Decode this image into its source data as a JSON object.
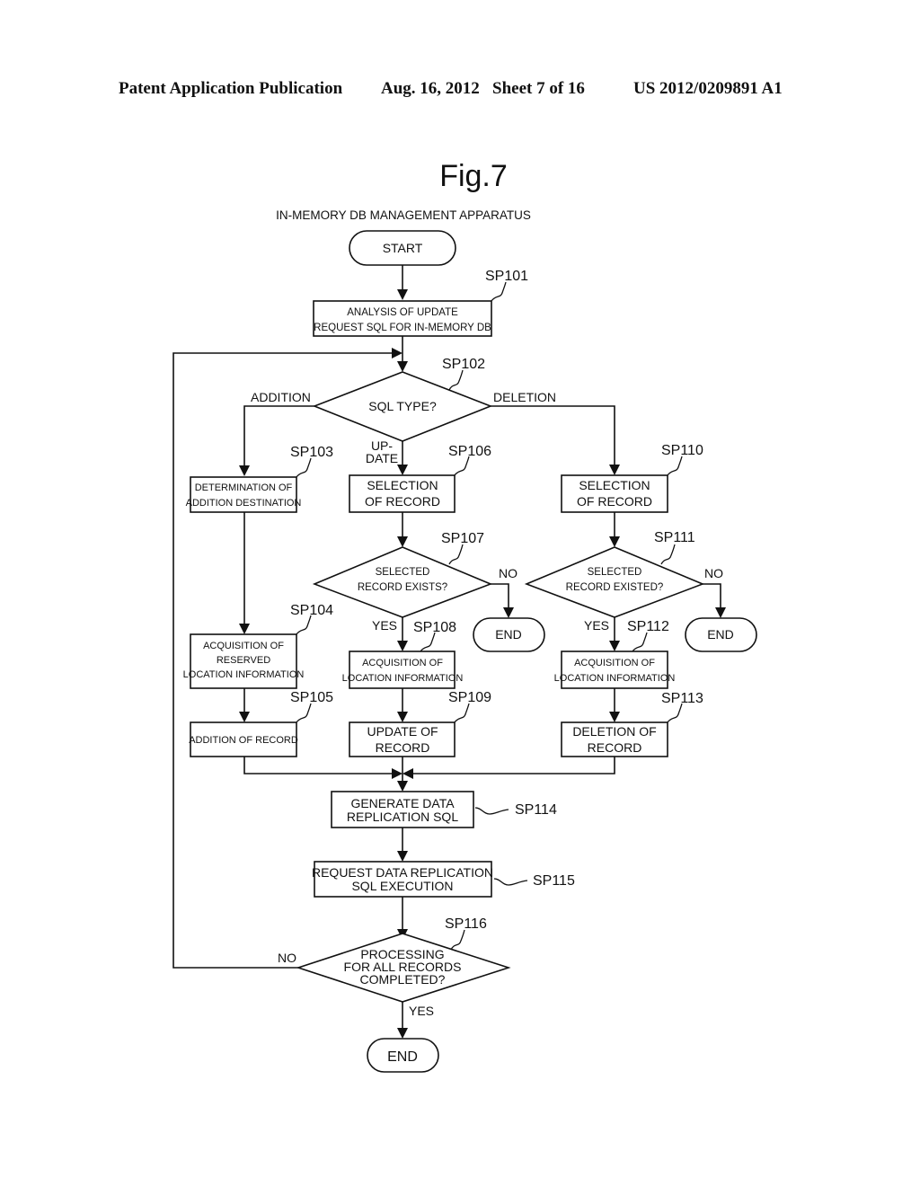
{
  "header": {
    "publication": "Patent Application Publication",
    "date": "Aug. 16, 2012",
    "sheet": "Sheet 7 of 16",
    "number": "US 2012/0209891 A1"
  },
  "figure": {
    "title": "Fig.7",
    "subtitle": "IN-MEMORY DB MANAGEMENT APPARATUS"
  },
  "nodes": {
    "start": {
      "label": "START"
    },
    "sp101": {
      "step": "SP101",
      "lines": [
        "ANALYSIS OF UPDATE",
        "REQUEST SQL FOR IN-MEMORY DB"
      ]
    },
    "sp102": {
      "step": "SP102",
      "lines": [
        "SQL TYPE?"
      ]
    },
    "sp103": {
      "step": "SP103",
      "lines": [
        "DETERMINATION OF",
        "ADDITION DESTINATION"
      ]
    },
    "sp104": {
      "step": "SP104",
      "lines": [
        "ACQUISITION OF",
        "RESERVED",
        "LOCATION INFORMATION"
      ]
    },
    "sp105": {
      "step": "SP105",
      "lines": [
        "ADDITION OF RECORD"
      ]
    },
    "sp106": {
      "step": "SP106",
      "lines": [
        "SELECTION",
        "OF RECORD"
      ]
    },
    "sp107": {
      "step": "SP107",
      "lines": [
        "SELECTED",
        "RECORD EXISTS?"
      ]
    },
    "sp108": {
      "step": "SP108",
      "lines": [
        "ACQUISITION OF",
        "LOCATION INFORMATION"
      ]
    },
    "sp109": {
      "step": "SP109",
      "lines": [
        "UPDATE OF",
        "RECORD"
      ]
    },
    "sp110": {
      "step": "SP110",
      "lines": [
        "SELECTION",
        "OF RECORD"
      ]
    },
    "sp111": {
      "step": "SP111",
      "lines": [
        "SELECTED",
        "RECORD EXISTED?"
      ]
    },
    "sp112": {
      "step": "SP112",
      "lines": [
        "ACQUISITION OF",
        "LOCATION INFORMATION"
      ]
    },
    "sp113": {
      "step": "SP113",
      "lines": [
        "DELETION OF",
        "RECORD"
      ]
    },
    "sp114": {
      "step": "SP114",
      "lines": [
        "GENERATE DATA",
        "REPLICATION SQL"
      ]
    },
    "sp115": {
      "step": "SP115",
      "lines": [
        "REQUEST DATA REPLICATION",
        "SQL EXECUTION"
      ]
    },
    "sp116": {
      "step": "SP116",
      "lines": [
        "PROCESSING",
        "FOR ALL RECORDS",
        "COMPLETED?"
      ]
    },
    "end1": {
      "label": "END"
    },
    "end2": {
      "label": "END"
    },
    "end3": {
      "label": "END"
    }
  },
  "branches": {
    "addition": "ADDITION",
    "deletion": "DELETION",
    "update_1": "UP-",
    "update_2": "DATE",
    "sp107_yes": "YES",
    "sp107_no": "NO",
    "sp111_yes": "YES",
    "sp111_no": "NO",
    "sp116_yes": "YES",
    "sp116_no": "NO"
  }
}
